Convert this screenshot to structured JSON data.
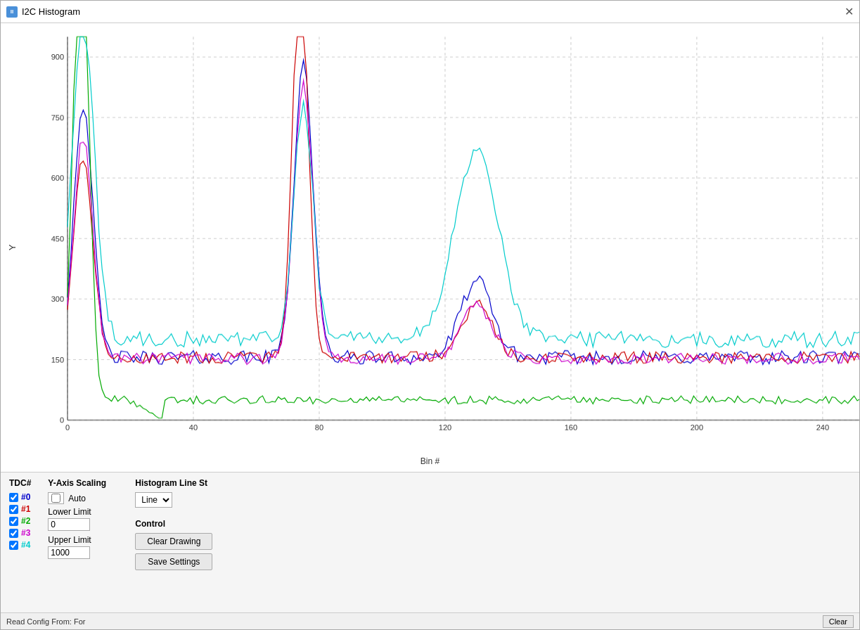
{
  "window": {
    "title": "I2C Histogram",
    "icon_label": "II"
  },
  "chart": {
    "y_axis_label": "Y",
    "x_axis_label": "Bin #",
    "y_ticks": [
      0,
      150,
      300,
      450,
      600,
      750,
      900
    ],
    "x_ticks": [
      0,
      40,
      80,
      120,
      160,
      200,
      240
    ],
    "colors": {
      "tdc0": "#0000cc",
      "tdc1": "#cc0000",
      "tdc2": "#00aa00",
      "tdc3": "#cc00cc",
      "tdc4": "#00cccc"
    }
  },
  "tdc": {
    "header": "TDC#",
    "items": [
      {
        "id": "#0",
        "checked": true,
        "color": "#0000cc"
      },
      {
        "id": "#1",
        "checked": true,
        "color": "#cc0000"
      },
      {
        "id": "#2",
        "checked": true,
        "color": "#00aa00"
      },
      {
        "id": "#3",
        "checked": true,
        "color": "#cc00cc"
      },
      {
        "id": "#4",
        "checked": true,
        "color": "#00cccc"
      }
    ]
  },
  "y_scaling": {
    "header": "Y-Axis Scaling",
    "auto_label": "Auto",
    "lower_limit_label": "Lower Limit",
    "lower_limit_value": "0",
    "upper_limit_label": "Upper Limit",
    "upper_limit_value": "1000"
  },
  "histogram_line": {
    "header": "Histogram Line St",
    "style_value": "Line"
  },
  "control": {
    "header": "Control",
    "clear_drawing_label": "Clear Drawing",
    "save_settings_label": "Save Settings"
  },
  "status_bar": {
    "left_text": "Read Config From: For",
    "right_text": "Clear"
  }
}
